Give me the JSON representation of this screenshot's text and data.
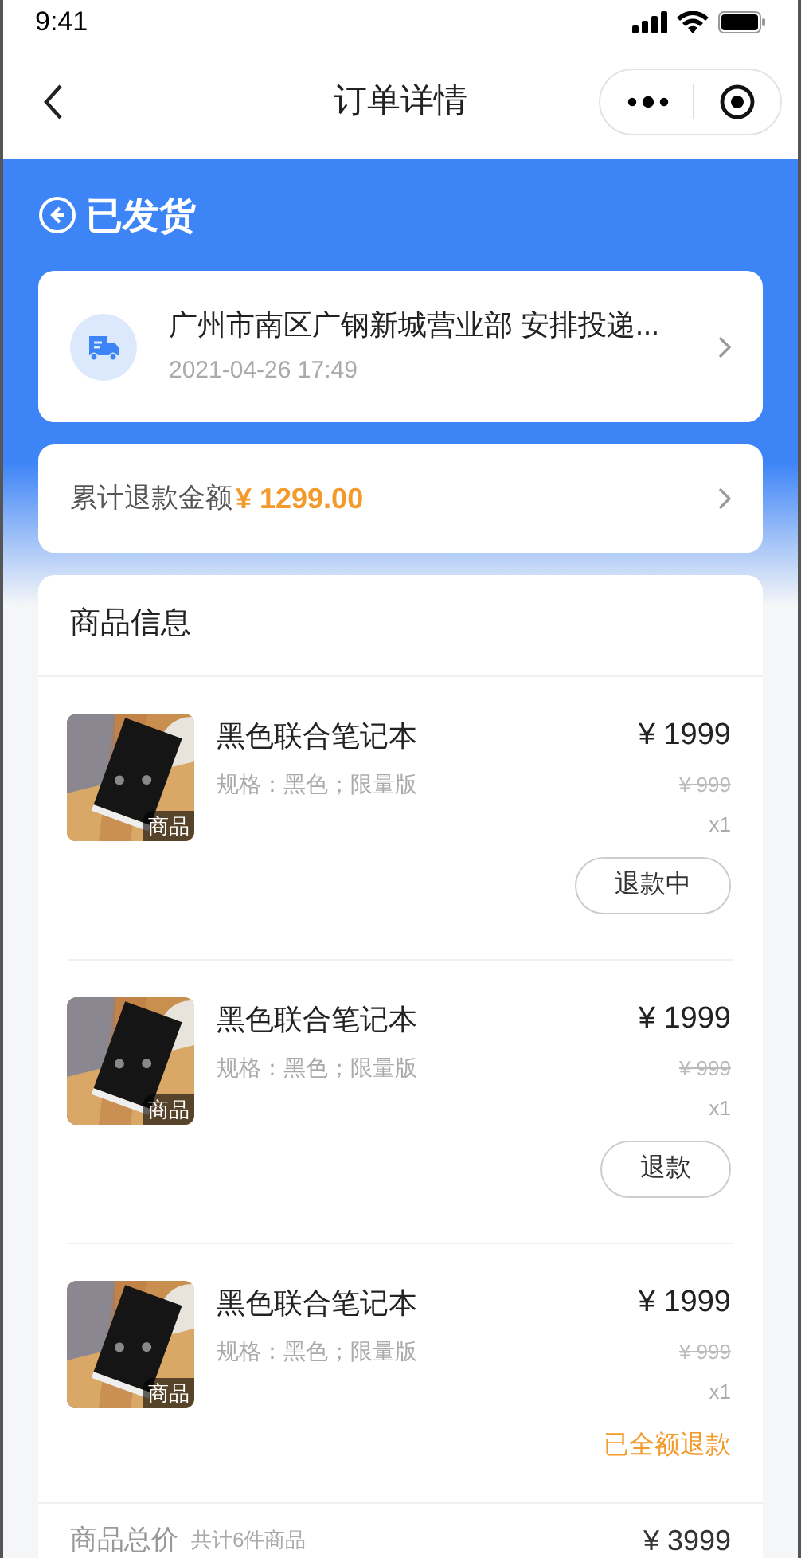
{
  "status_bar": {
    "time": "9:41"
  },
  "nav": {
    "title": "订单详情"
  },
  "order_status": {
    "label": "已发货"
  },
  "logistics": {
    "text": "广州市南区广钢新城营业部 安排投递...",
    "time": "2021-04-26 17:49"
  },
  "refund_total": {
    "label": "累计退款金额",
    "amount": "¥ 1299.00"
  },
  "goods": {
    "title": "商品信息",
    "items": [
      {
        "name": "黑色联合笔记本",
        "spec": "规格：黑色；限量版",
        "badge": "商品",
        "price": "¥ 1999",
        "original_price": "¥ 999",
        "quantity": "x1",
        "action": {
          "kind": "button",
          "label": "退款中"
        }
      },
      {
        "name": "黑色联合笔记本",
        "spec": "规格：黑色；限量版",
        "badge": "商品",
        "price": "¥ 1999",
        "original_price": "¥ 999",
        "quantity": "x1",
        "action": {
          "kind": "button",
          "label": "退款"
        }
      },
      {
        "name": "黑色联合笔记本",
        "spec": "规格：黑色；限量版",
        "badge": "商品",
        "price": "¥ 1999",
        "original_price": "¥ 999",
        "quantity": "x1",
        "action": {
          "kind": "status",
          "label": "已全额退款"
        }
      }
    ],
    "total": {
      "label": "商品总价",
      "count": "共计6件商品",
      "amount": "¥ 3999"
    }
  }
}
